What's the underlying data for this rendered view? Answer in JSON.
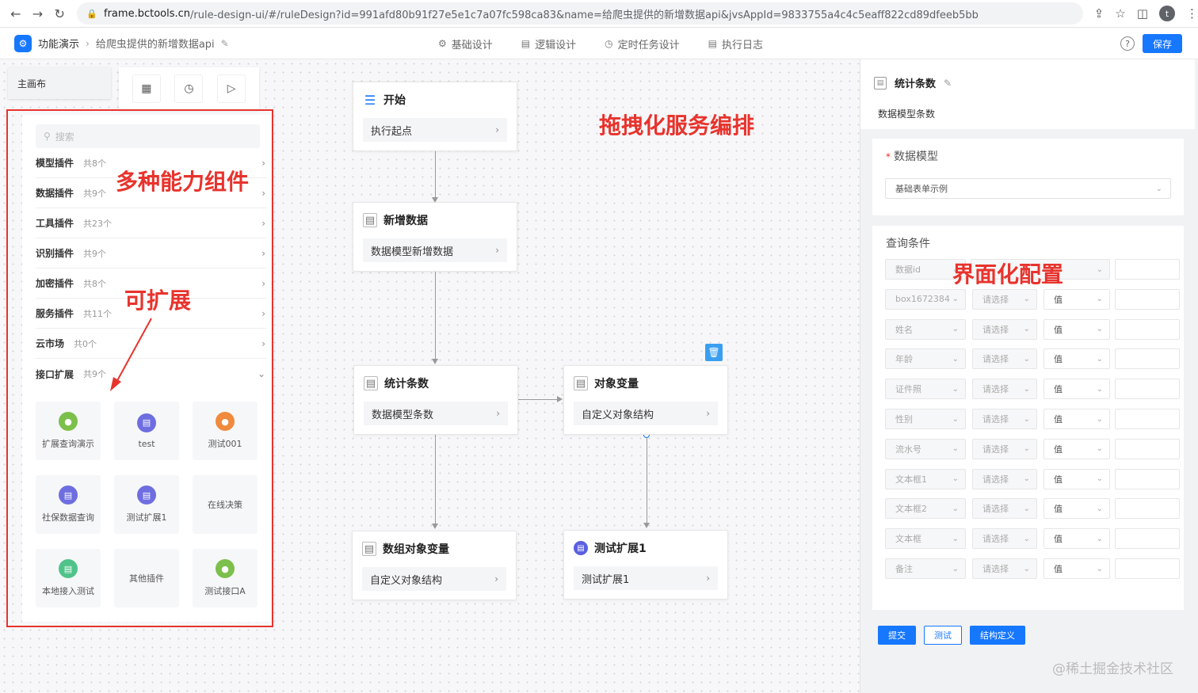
{
  "browser": {
    "url_host": "frame.bctools.cn",
    "url_path": "/rule-design-ui/#/ruleDesign?id=991afd80b91f27e5e1c7a07fc598ca83&name=给爬虫提供的新增数据api&jvsAppId=9833755a4c4c5eaff822cd89dfeeb5bb",
    "avatar_letter": "t"
  },
  "header": {
    "app_name": "功能演示",
    "page_name": "给爬虫提供的新增数据api",
    "tabs": [
      {
        "label": "基础设计",
        "icon": "settings-icon"
      },
      {
        "label": "逻辑设计",
        "icon": "logic-icon"
      },
      {
        "label": "定时任务设计",
        "icon": "clock-icon"
      },
      {
        "label": "执行日志",
        "icon": "log-icon"
      }
    ],
    "save_label": "保存"
  },
  "palette": {
    "main_canvas_tab": "主画布",
    "search_placeholder": "搜索",
    "categories": [
      {
        "name": "模型插件",
        "count": "共8个"
      },
      {
        "name": "数据插件",
        "count": "共9个"
      },
      {
        "name": "工具插件",
        "count": "共23个"
      },
      {
        "name": "识别插件",
        "count": "共9个"
      },
      {
        "name": "加密插件",
        "count": "共8个"
      },
      {
        "name": "服务插件",
        "count": "共11个"
      },
      {
        "name": "云市场",
        "count": "共0个"
      },
      {
        "name": "接口扩展",
        "count": "共9个"
      }
    ],
    "extensions": [
      {
        "label": "扩展查询演示",
        "color": "#7cc04b",
        "icon": "chat-icon"
      },
      {
        "label": "test",
        "color": "#6e6ee0",
        "icon": "chart-icon"
      },
      {
        "label": "测试001",
        "color": "#f08a3c",
        "icon": "people-icon"
      },
      {
        "label": "社保数据查询",
        "color": "#6e6ee0",
        "icon": "chart-icon"
      },
      {
        "label": "测试扩展1",
        "color": "#6e6ee0",
        "icon": "doc-icon"
      },
      {
        "label": "在线决策",
        "color": "",
        "icon": ""
      },
      {
        "label": "本地接入测试",
        "color": "#4fc38a",
        "icon": "card-icon"
      },
      {
        "label": "其他插件",
        "color": "",
        "icon": ""
      },
      {
        "label": "测试接口A",
        "color": "#7cc04b",
        "icon": "chat-icon"
      }
    ]
  },
  "flow": {
    "nodes": [
      {
        "title": "开始",
        "body": "执行起点"
      },
      {
        "title": "新增数据",
        "body": "数据模型新增数据"
      },
      {
        "title": "统计条数",
        "body": "数据模型条数"
      },
      {
        "title": "对象变量",
        "body": "自定义对象结构"
      },
      {
        "title": "数组对象变量",
        "body": "自定义对象结构"
      },
      {
        "title": "测试扩展1",
        "body": "测试扩展1"
      }
    ]
  },
  "annotations": {
    "components": "多种能力组件",
    "extensible": "可扩展",
    "orchestration": "拖拽化服务编排",
    "config": "界面化配置"
  },
  "right_panel": {
    "title": "统计条数",
    "subtitle": "数据模型条数",
    "model_label": "数据模型",
    "model_value": "基础表单示例",
    "query_label": "查询条件",
    "query_rows": [
      {
        "field": "数据id",
        "op": "",
        "type": ""
      },
      {
        "field": "box1672384",
        "op": "请选择",
        "type": "值"
      },
      {
        "field": "姓名",
        "op": "请选择",
        "type": "值"
      },
      {
        "field": "年龄",
        "op": "请选择",
        "type": "值"
      },
      {
        "field": "证件照",
        "op": "请选择",
        "type": "值"
      },
      {
        "field": "性别",
        "op": "请选择",
        "type": "值"
      },
      {
        "field": "流水号",
        "op": "请选择",
        "type": "值"
      },
      {
        "field": "文本框1",
        "op": "请选择",
        "type": "值"
      },
      {
        "field": "文本框2",
        "op": "请选择",
        "type": "值"
      },
      {
        "field": "文本框",
        "op": "请选择",
        "type": "值"
      },
      {
        "field": "备注",
        "op": "请选择",
        "type": "值"
      }
    ],
    "buttons": {
      "submit": "提交",
      "test": "测试",
      "struct": "结构定义"
    }
  },
  "watermark": "@稀土掘金技术社区"
}
